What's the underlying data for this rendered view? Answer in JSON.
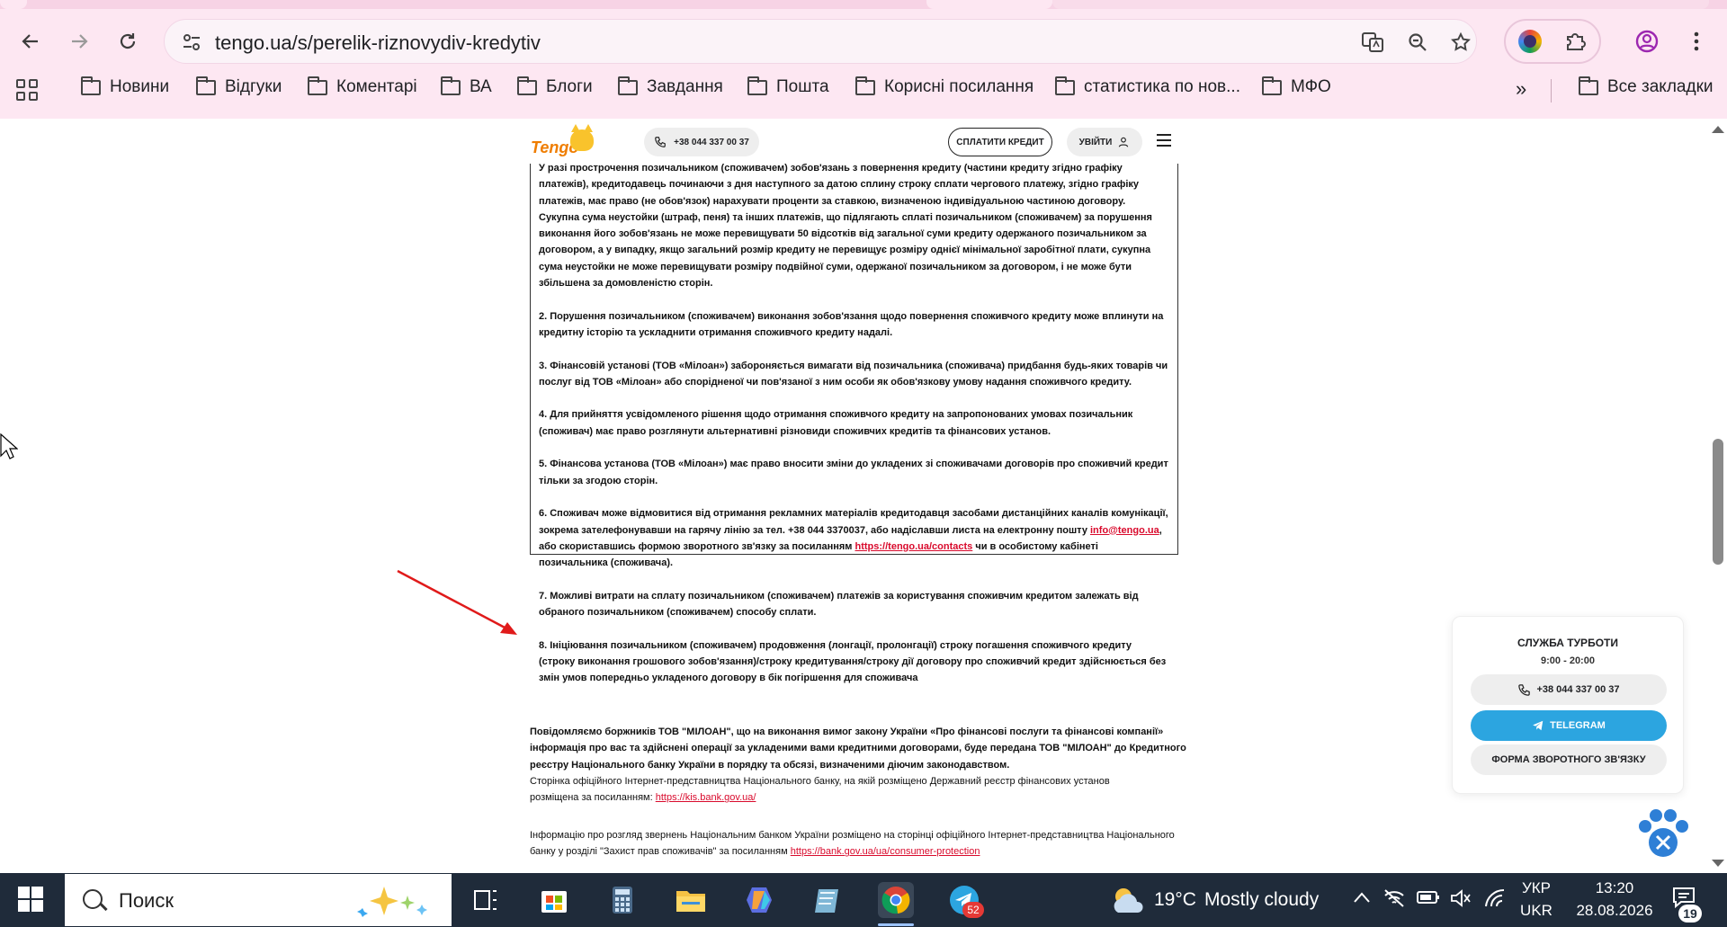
{
  "browser": {
    "url": "tengo.ua/s/perelik-riznovydiv-kredytiv",
    "bookmarks": [
      {
        "label": "Новини"
      },
      {
        "label": "Відгуки"
      },
      {
        "label": "Коментарі"
      },
      {
        "label": "ВА"
      },
      {
        "label": "Блоги"
      },
      {
        "label": "Завдання"
      },
      {
        "label": "Пошта"
      },
      {
        "label": "Корисні посилання"
      },
      {
        "label": "статистика по нов..."
      },
      {
        "label": "МФО"
      }
    ],
    "all_bookmarks": "Все закладки",
    "more_chevron": "»"
  },
  "site_header": {
    "logo": "Tengo",
    "phone": "+38 044 337 00 37",
    "pay_label": "СПЛАТИТИ КРЕДИТ",
    "login_label": "УВІЙТИ"
  },
  "terms": {
    "p0a": "У разі прострочення позичальником (споживачем) зобов'язань з повернення кредиту (частини кредиту згідно графіку платежів), кредитодавець починаючи з дня наступного за датою сплину строку сплати чергового платежу, згідно графіку платежів, має право (не обов'язок) нарахувати проценти за ставкою, визначеною індивідуальною частиною договору.",
    "p0b": "Сукупна сума неустойки (штраф, пеня) та інших платежів, що підлягають сплаті позичальником (споживачем) за порушення виконання його зобов'язань не може перевищувати 50 відсотків від загальної суми кредиту одержаного позичальником за договором, а у випадку, якщо загальний розмір кредиту не перевищує розміру однієї мінімальної заробітної плати, сукупна сума неустойки не може перевищувати розміру подвійної суми, одержаної позичальником за договором, і не може бути збільшена за домовленістю сторін.",
    "p2": "2. Порушення позичальником (споживачем) виконання зобов'язання щодо повернення споживчого кредиту може вплинути на кредитну історію та ускладнити отримання споживчого кредиту надалі.",
    "p3": "3. Фінансовій установі (ТОВ «Мілоан») забороняється вимагати від позичальника (споживача) придбання будь-яких товарів чи послуг від ТОВ «Мілоан» або спорідненої чи пов'язаної з ним особи як обов'язкову умову надання споживчого кредиту.",
    "p4": "4. Для прийняття усвідомленого рішення щодо отримання споживчого кредиту на запропонованих умовах позичальник (споживач) має право розглянути альтернативні різновиди споживчих кредитів та фінансових установ.",
    "p5": "5. Фінансова установа (ТОВ «Мілоан») має право вносити зміни до укладених зі споживачами договорів про споживчий кредит тільки за згодою сторін.",
    "p6_a": "6. Споживач може відмовитися від отримання рекламних матеріалів кредитодавця засобами дистанційних каналів комунікації, зокрема зателефонувавши на гарячу лінію за тел. +38 044 3370037, або надіславши листа на електронну пошту ",
    "p6_email": "info@tengo.ua",
    "p6_b": ", або скориставшись формою зворотного зв'язку за посиланням ",
    "p6_link": "https://tengo.ua/contacts",
    "p6_c": " чи в особистому кабінеті позичальника (споживача).",
    "p7": "7. Можливі витрати на сплату позичальником (споживачем) платежів за користування споживчим кредитом залежать від обраного позичальником (споживачем) способу сплати.",
    "p8": "8. Ініціювання позичальником (споживачем) продовження (лонгації, пролонгації) строку погашення споживчого кредиту (строку виконання грошового зобов'язання)/строку кредитування/строку дії договору про споживчий кредит здійснюється без змін умов попередньо укладеного договору в бік погіршення для споживача"
  },
  "below": {
    "notice": "Повідомляємо боржників ТОВ \"МІЛОАН\", що на виконання вимог закону України «Про фінансові послуги та фінансові компанії» інформація про вас та здійснені операції за укладеними вами кредитними договорами, буде передана ТОВ \"МІЛОАН\" до Кредитного реєстру Національного банку України в порядку та обсязі, визначеними діючим законодавством.",
    "registry_text": "Сторінка офіційного Інтернет-представництва Національного банку, на якій розміщено Державний реєстр фінансових установ розміщена за посиланням: ",
    "registry_link": "https://kis.bank.gov.ua/",
    "appeals_text": "Інформацію про розгляд звернень Національним банком України розміщено на сторінці офіційного Інтернет-представництва Національного банку у розділі \"Захист прав споживачів\" за посиланням ",
    "appeals_link": "https://bank.gov.ua/ua/consumer-protection"
  },
  "care": {
    "title": "СЛУЖБА ТУРБОТИ",
    "hours": "9:00 - 20:00",
    "phone": "+38 044 337 00 37",
    "telegram": "TELEGRAM",
    "form": "ФОРМА ЗВОРОТНОГО ЗВ'ЯЗКУ"
  },
  "taskbar": {
    "search_placeholder": "Поиск",
    "weather_temp": "19°C",
    "weather_desc": "Mostly cloudy",
    "lang_top": "УКР",
    "lang_bottom": "UKR",
    "time": "13:20",
    "date": "28.08.2026",
    "telegram_badge": "52",
    "notifications": "19"
  },
  "colors": {
    "chrome_bg": "#fde7f2",
    "link_red": "#d90a2c",
    "telegram_blue": "#2ca5e0",
    "taskbar": "#1f2b3a",
    "arrow_red": "#e01a1a"
  }
}
